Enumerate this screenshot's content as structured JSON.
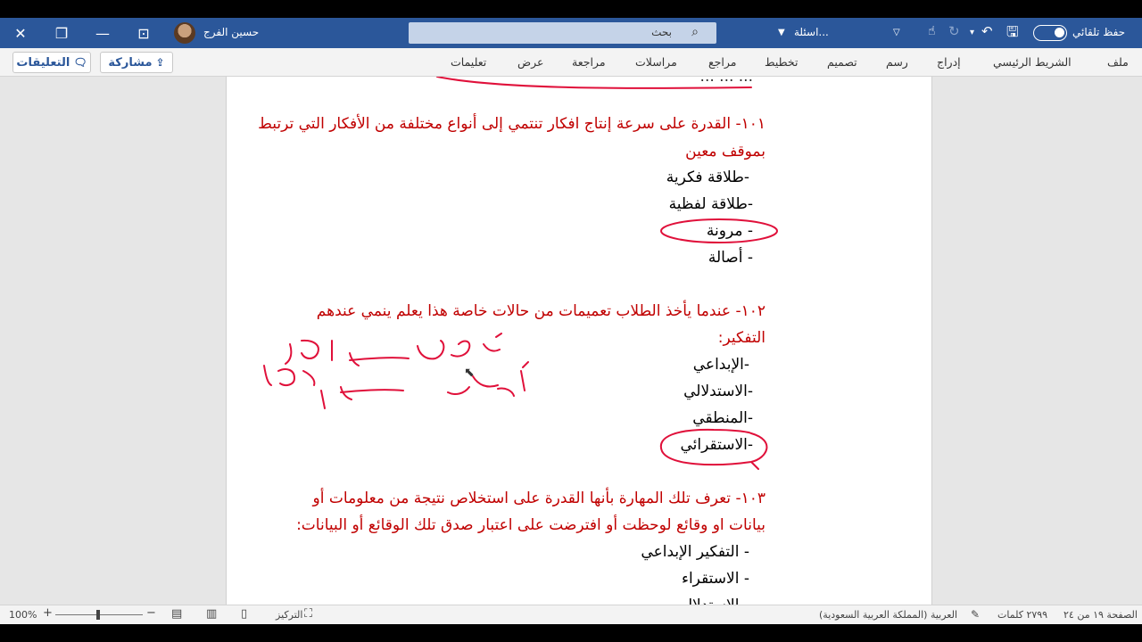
{
  "titlebar": {
    "autosave_label": "حفظ تلقائي",
    "doc_name": "اسئلة...",
    "search_label": "بحث",
    "user_name": "حسين الفرج"
  },
  "ribbon": {
    "tabs": [
      "ملف",
      "الشريط الرئيسي",
      "إدراج",
      "رسم",
      "تصميم",
      "تخطيط",
      "مراجع",
      "مراسلات",
      "مراجعة",
      "عرض",
      "تعليمات"
    ],
    "share_label": "مشاركة",
    "comments_label": "التعليقات"
  },
  "document": {
    "top_fragment": "... ... ...",
    "q101": {
      "line1": "١٠١- القدرة على سرعة إنتاج افكار تنتمي إلى أنواع مختلفة من الأفكار التي ترتبط",
      "line2": "بموقف معين",
      "options": [
        "-طلاقة فكرية",
        "-طلاقة لفظية",
        "- مرونة",
        "- أصالة"
      ]
    },
    "q102": {
      "line1": "١٠٢- عندما يأخذ الطلاب تعميمات من حالات خاصة هذا يعلم ينمي عندهم",
      "line2": "التفكير:",
      "options": [
        "-الإبداعي",
        "-الاستدلالي",
        "-المنطقي",
        "-الاستقرائي"
      ]
    },
    "q103": {
      "line1": "١٠٣- تعرف تلك المهارة بأنها القدرة على استخلاص نتيجة من معلومات أو",
      "line2": "بيانات او وقائع لوحظت أو افترضت على اعتبار صدق تلك الوقائع أو البيانات:",
      "options": [
        "- التفكير الإبداعي",
        "- الاستقراء",
        "- الاستدلال"
      ]
    }
  },
  "statusbar": {
    "page": "الصفحة ١٩ من ٢٤",
    "words": "٢٧٩٩ كلمات",
    "language": "العربية (المملكة العربية السعودية)",
    "focus": "التركيز",
    "zoom": "100%"
  },
  "colors": {
    "accent": "#2b579a",
    "question": "#c00000",
    "ink": "#e0103a"
  }
}
